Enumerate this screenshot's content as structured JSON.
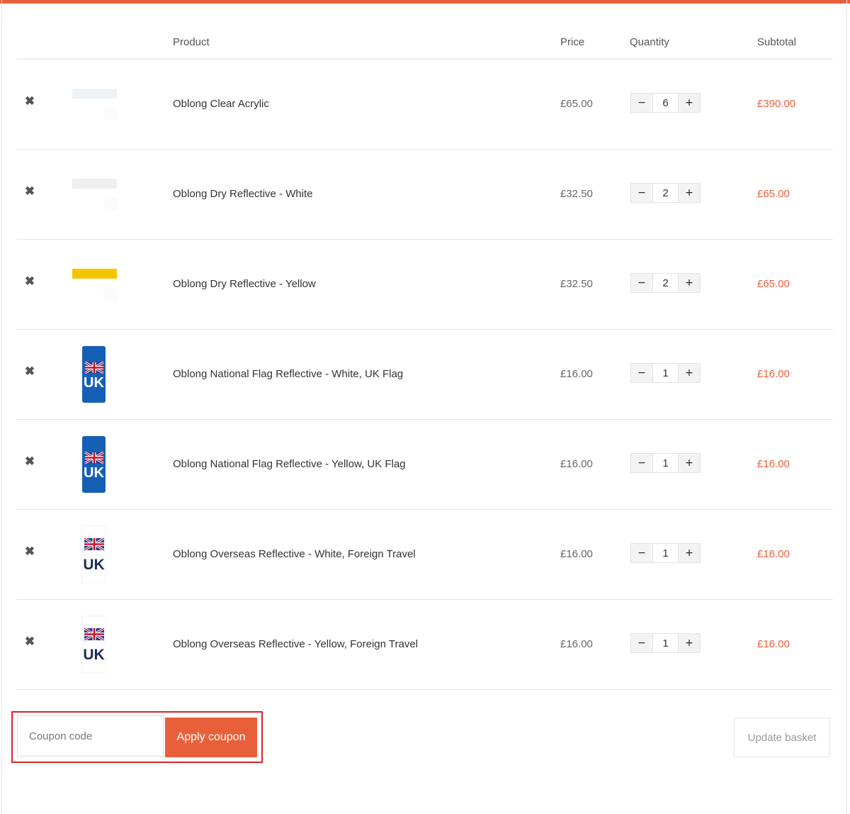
{
  "colors": {
    "accent": "#e8603a",
    "highlight_border": "#d9232a"
  },
  "cart": {
    "headers": {
      "product": "Product",
      "price": "Price",
      "quantity": "Quantity",
      "subtotal": "Subtotal"
    },
    "items": [
      {
        "thumbnail": "clear-plate",
        "name": "Oblong Clear Acrylic",
        "price": "£65.00",
        "quantity": "6",
        "subtotal": "£390.00",
        "remove_icon": "close-icon"
      },
      {
        "thumbnail": "white-plate",
        "name": "Oblong Dry Reflective - White",
        "price": "£32.50",
        "quantity": "2",
        "subtotal": "£65.00",
        "remove_icon": "close-icon"
      },
      {
        "thumbnail": "yellow-plate",
        "name": "Oblong Dry Reflective - Yellow",
        "price": "£32.50",
        "quantity": "2",
        "subtotal": "£65.00",
        "remove_icon": "close-icon"
      },
      {
        "thumbnail": "uk-flag-blue-badge",
        "name": "Oblong National Flag Reflective - White, UK Flag",
        "price": "£16.00",
        "quantity": "1",
        "subtotal": "£16.00",
        "remove_icon": "close-icon"
      },
      {
        "thumbnail": "uk-flag-blue-badge",
        "name": "Oblong National Flag Reflective - Yellow, UK Flag",
        "price": "£16.00",
        "quantity": "1",
        "subtotal": "£16.00",
        "remove_icon": "close-icon"
      },
      {
        "thumbnail": "uk-flag-white-badge",
        "name": "Oblong Overseas Reflective - White, Foreign Travel",
        "price": "£16.00",
        "quantity": "1",
        "subtotal": "£16.00",
        "remove_icon": "close-icon"
      },
      {
        "thumbnail": "uk-flag-white-badge",
        "name": "Oblong Overseas Reflective - Yellow, Foreign Travel",
        "price": "£16.00",
        "quantity": "1",
        "subtotal": "£16.00",
        "remove_icon": "close-icon"
      }
    ],
    "qty_minus": "−",
    "qty_plus": "+",
    "remove_glyph": "✖",
    "badge_text": "UK"
  },
  "coupon": {
    "placeholder": "Coupon code",
    "apply_label": "Apply coupon"
  },
  "update_label": "Update basket"
}
